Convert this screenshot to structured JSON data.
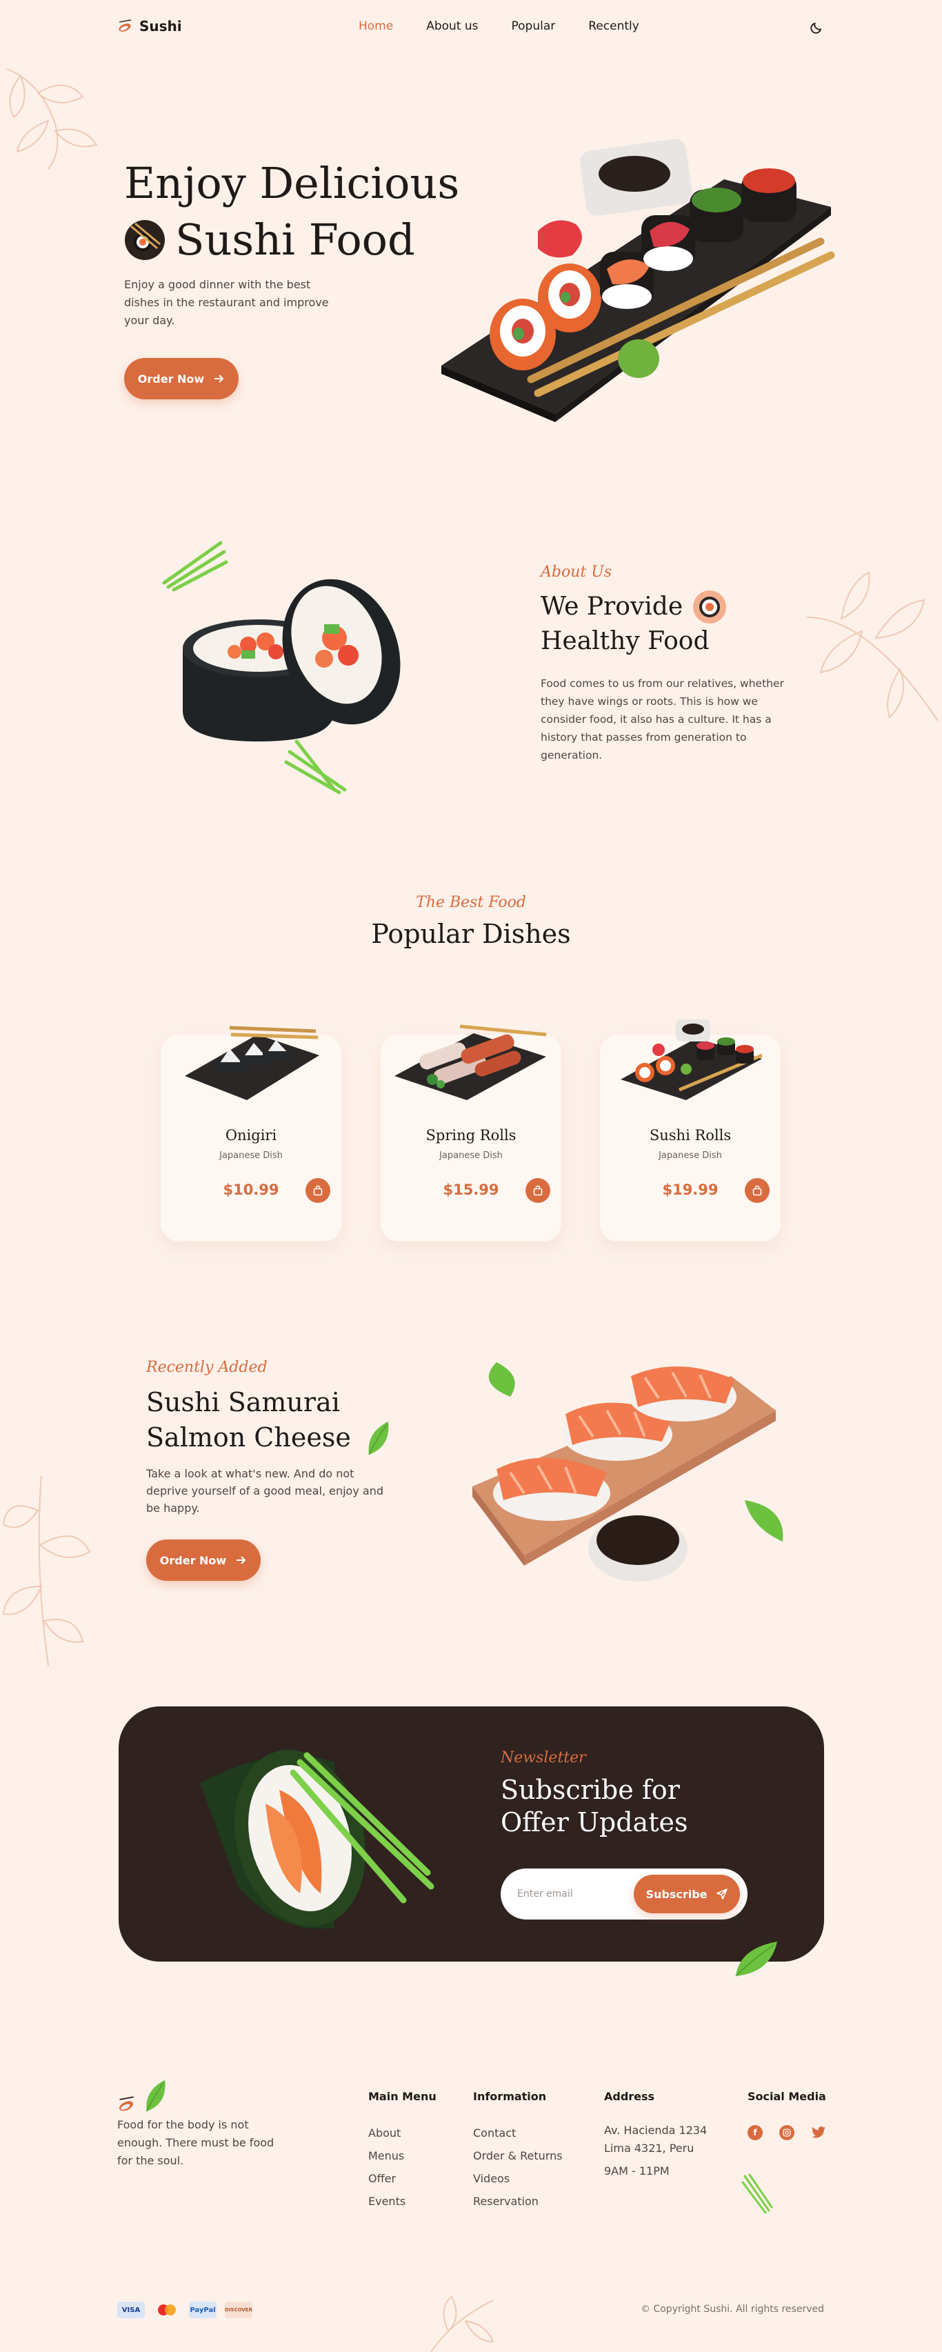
{
  "brand": {
    "name": "Sushi"
  },
  "nav": {
    "items": [
      "Home",
      "About us",
      "Popular",
      "Recently"
    ]
  },
  "hero": {
    "title_line1": "Enjoy Delicious",
    "title_line2": "Sushi Food",
    "description": "Enjoy a good dinner with the best dishes in the restaurant and improve your day.",
    "button_label": "Order Now"
  },
  "about": {
    "subtitle": "About Us",
    "title_line1": "We Provide",
    "title_line2": "Healthy Food",
    "description": "Food comes to us from our relatives, whether they have wings or roots. This is how we consider food, it also has a culture. It has a history that passes from generation to generation."
  },
  "popular": {
    "subtitle": "The Best Food",
    "title": "Popular Dishes",
    "dishes": [
      {
        "name": "Onigiri",
        "category": "Japanese Dish",
        "price": "$10.99"
      },
      {
        "name": "Spring Rolls",
        "category": "Japanese Dish",
        "price": "$15.99"
      },
      {
        "name": "Sushi Rolls",
        "category": "Japanese Dish",
        "price": "$19.99"
      }
    ]
  },
  "recently": {
    "subtitle": "Recently Added",
    "title_line1": "Sushi Samurai",
    "title_line2": "Salmon Cheese",
    "description": "Take a look at what's new. And do not deprive yourself of a good meal, enjoy and be happy.",
    "button_label": "Order Now"
  },
  "newsletter": {
    "subtitle": "Newsletter",
    "title_line1": "Subscribe for",
    "title_line2": "Offer Updates",
    "email_placeholder": "Enter email",
    "button_label": "Subscribe"
  },
  "footer": {
    "description": "Food for the body is not enough. There must be food for the soul.",
    "columns": [
      {
        "heading": "Main Menu",
        "links": [
          "About",
          "Menus",
          "Offer",
          "Events"
        ]
      },
      {
        "heading": "Information",
        "links": [
          "Contact",
          "Order & Returns",
          "Videos",
          "Reservation"
        ]
      }
    ],
    "address": {
      "heading": "Address",
      "line1": "Av. Hacienda 1234",
      "line2": "Lima 4321, Peru",
      "hours": "9AM - 11PM"
    },
    "social": {
      "heading": "Social Media",
      "icons": [
        "facebook-icon",
        "instagram-icon",
        "twitter-icon"
      ]
    },
    "payments": [
      "VISA",
      "mastercard",
      "PayPal",
      "DISCOVER"
    ],
    "copyright": "© Copyright Sushi. All rights reserved"
  },
  "colors": {
    "accent": "#d96c3f",
    "background": "#fdf1ea",
    "dark": "#2f221f"
  }
}
